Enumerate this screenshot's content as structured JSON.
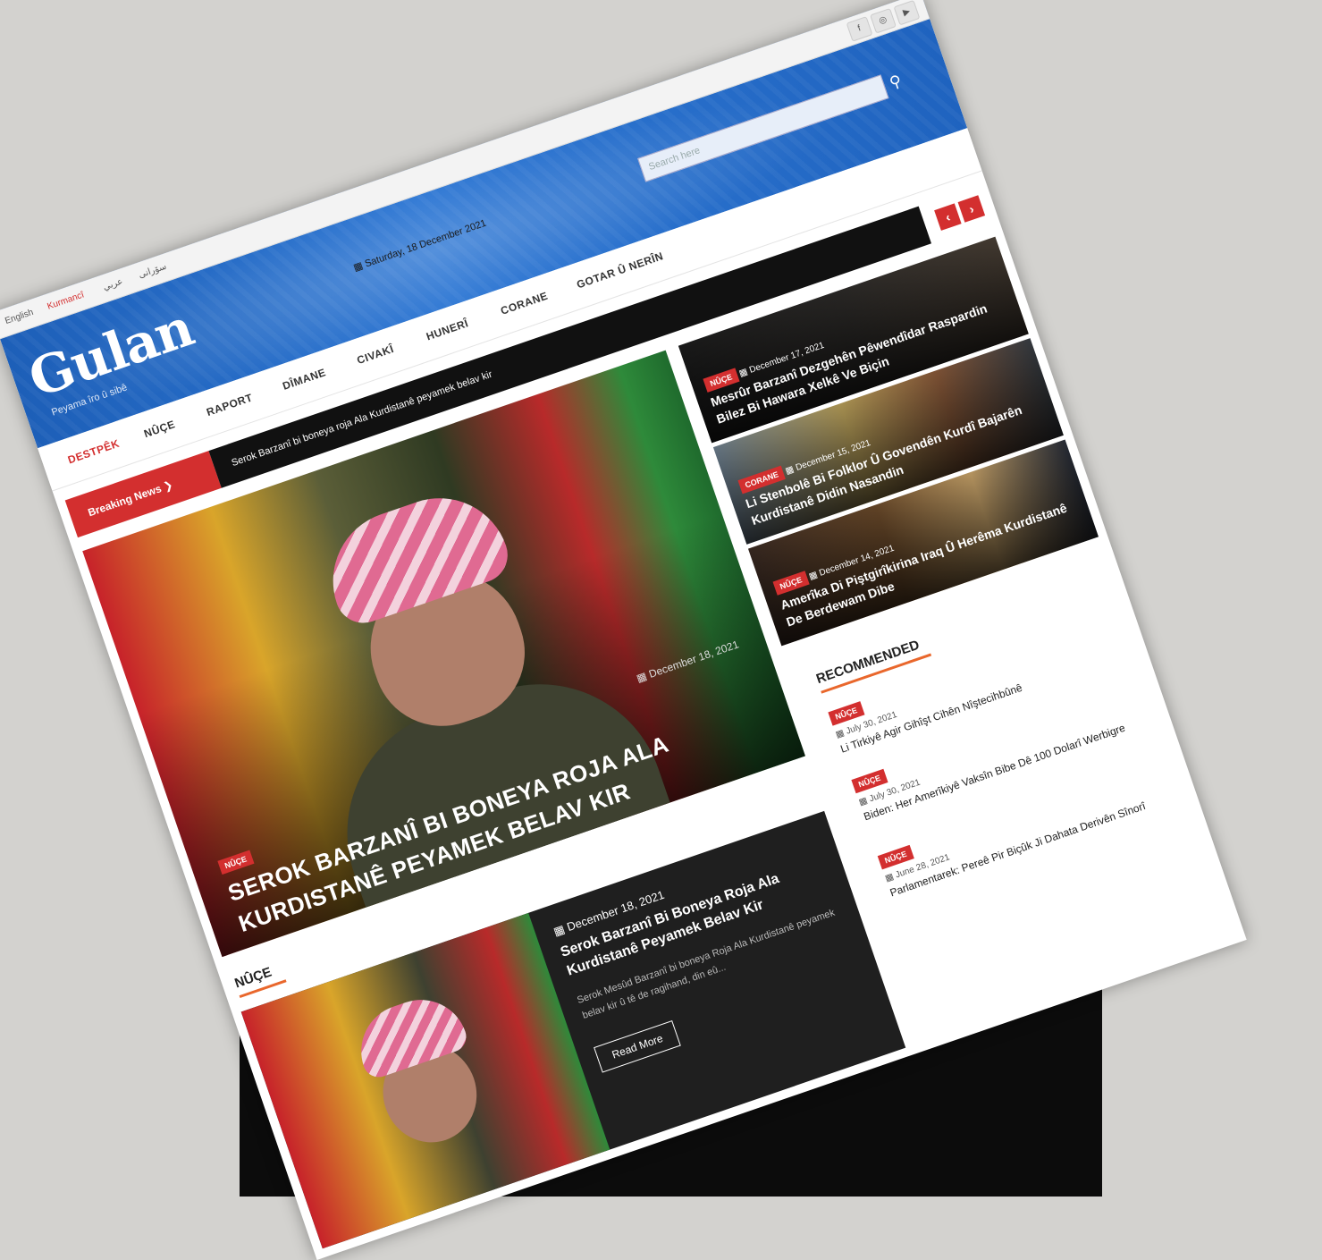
{
  "languages": [
    "English",
    "Kurmancî",
    "عربي",
    "سۆرانی"
  ],
  "active_language": "Kurmancî",
  "social_icons": [
    "facebook-icon",
    "instagram-icon",
    "youtube-icon"
  ],
  "site": {
    "logo": "Gulan",
    "tagline": "Peyama îro û sibê"
  },
  "header": {
    "date": "Saturday, 18 December 2021",
    "search_placeholder": "Search here"
  },
  "nav": [
    "DESTPÊK",
    "NÛÇE",
    "RAPORT",
    "DÎMANE",
    "CIVAKÎ",
    "HUNERÎ",
    "CORANE",
    "GOTAR Û NERÎN"
  ],
  "breaking": {
    "label": "Breaking News",
    "text": "Serok Barzanî bi boneya roja Ala Kurdistanê peyamek belav kir",
    "prev": "‹",
    "next": "›"
  },
  "feature": {
    "category": "NÛÇE",
    "date": "December 18, 2021",
    "title": "SEROK BARZANÎ BI BONEYA ROJA ALA KURDISTANÊ PEYAMEK BELAV KIR"
  },
  "side_posts": [
    {
      "category": "NÛÇE",
      "date": "December 17, 2021",
      "title": "Mesrûr Barzanî Dezgehên Pêwendîdar Raspardin Bilez Bi Hawara Xelkê Ve Biçin"
    },
    {
      "category": "CORANE",
      "date": "December 15, 2021",
      "title": "Li Stenbolê Bi Folklor Û Govendên Kurdî Bajarên Kurdistanê Didin Nasandin"
    },
    {
      "category": "NÛÇE",
      "date": "December 14, 2021",
      "title": "Amerîka Di Piştgirîkirina Iraq Û Herêma Kurdistanê De Berdewam Dibe"
    }
  ],
  "sections": {
    "news": "NÛÇE",
    "recommended": "RECOMMENDED"
  },
  "news_card": {
    "date": "December 18, 2021",
    "title": "Serok Barzanî Bi Boneya Roja Ala Kurdistanê Peyamek Belav Kir",
    "excerpt": "Serok Mesûd Barzanî bi boneya Roja Ala Kurdistanê peyamek belav kir û tê de ragihand, din eû...",
    "read_more": "Read More"
  },
  "recommended": [
    {
      "category": "NÛÇE",
      "date": "July 30, 2021",
      "title": "Li Tirkiyê Agir Gihîşt Cihên Nîştecihbûnê"
    },
    {
      "category": "NÛÇE",
      "date": "July 30, 2021",
      "title": "Biden: Her Amerîkiyê Vaksîn Bibe Dê 100 Dolarî Werbigre"
    },
    {
      "category": "NÛÇE",
      "date": "June 28, 2021",
      "title": "Parlamentarek: Pereê Pir Biçûk Ji Dahata Derivên Sînorî"
    }
  ],
  "colors": {
    "accent": "#d32f2f",
    "header_blue": "#2f78d4",
    "underline": "#e9672c"
  }
}
